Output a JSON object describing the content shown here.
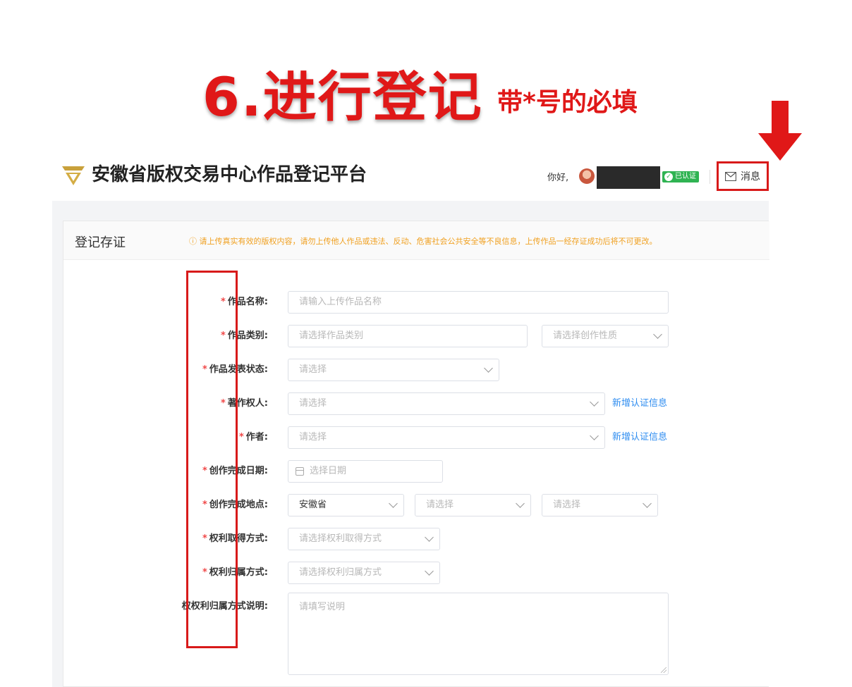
{
  "tutorial": {
    "step_title": "6.进行登记",
    "note": "带*号的必填"
  },
  "header": {
    "site_title": "安徽省版权交易中心作品登记平台",
    "greeting": "你好,",
    "verified_label": "已认证",
    "messages_label": "消息"
  },
  "card": {
    "title": "登记存证",
    "warning": "ⓘ 请上传真实有效的版权内容，请勿上传他人作品或违法、反动、危害社会公共安全等不良信息，上传作品一经存证成功后将不可更改。"
  },
  "form": {
    "required_mark": "*",
    "work_name": {
      "label": "作品名称:",
      "placeholder": "请输入上传作品名称"
    },
    "work_category": {
      "label": "作品类别:",
      "placeholder": "请选择作品类别",
      "nature_placeholder": "请选择创作性质"
    },
    "publish_status": {
      "label": "作品发表状态:",
      "placeholder": "请选择"
    },
    "copyright_owner": {
      "label": "著作权人:",
      "placeholder": "请选择",
      "link": "新增认证信息"
    },
    "author": {
      "label": "作者:",
      "placeholder": "请选择",
      "link": "新增认证信息"
    },
    "completion_date": {
      "label": "创作完成日期:",
      "placeholder": "选择日期"
    },
    "completion_place": {
      "label": "创作完成地点:",
      "province": "安徽省",
      "city_placeholder": "请选择",
      "district_placeholder": "请选择"
    },
    "acquisition_method": {
      "label": "权利取得方式:",
      "placeholder": "请选择权利取得方式"
    },
    "ownership_method": {
      "label": "权利归属方式:",
      "placeholder": "请选择权利归属方式"
    },
    "ownership_description": {
      "label": "权权利归属方式说明:",
      "placeholder": "请填写说明"
    }
  },
  "colors": {
    "annotation_red": "#e01818",
    "link_blue": "#2d8cf0",
    "warning_orange": "#f0a020",
    "verified_green": "#2fb352"
  }
}
